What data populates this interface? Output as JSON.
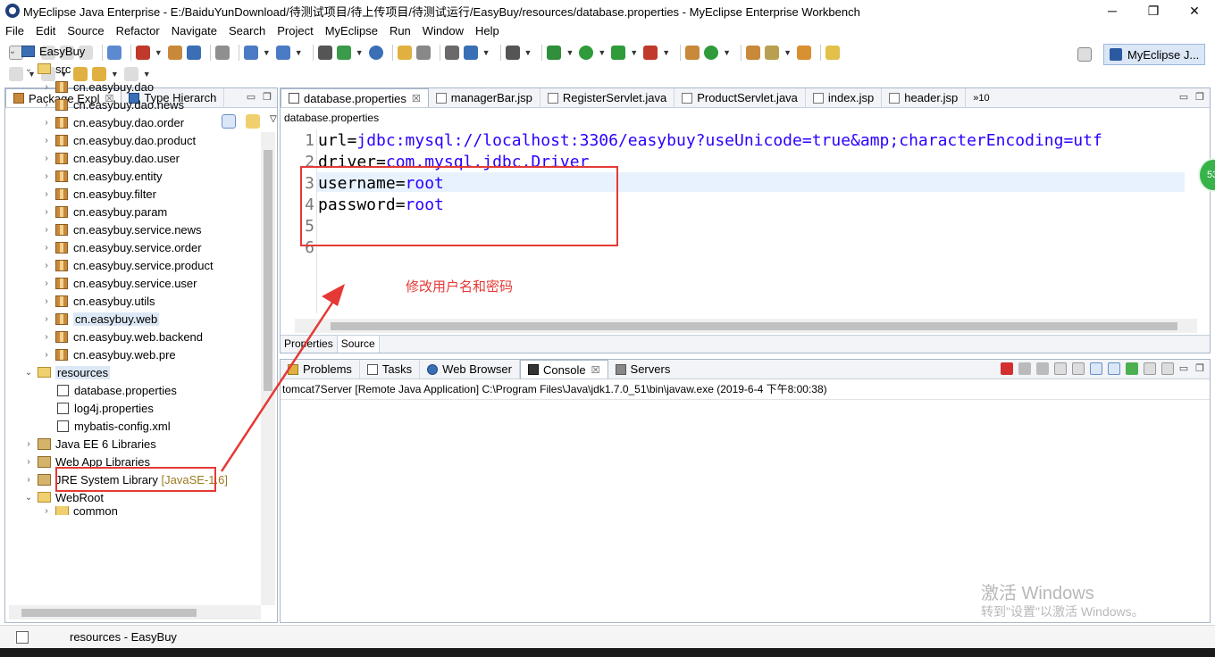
{
  "window": {
    "title": "MyEclipse Java Enterprise - E:/BaiduYunDownload/待测试项目/待上传项目/待测试运行/EasyBuy/resources/database.properties - MyEclipse Enterprise Workbench",
    "min": "─",
    "max": "❐",
    "close": "✕"
  },
  "menu": [
    "File",
    "Edit",
    "Source",
    "Refactor",
    "Navigate",
    "Search",
    "Project",
    "MyEclipse",
    "Run",
    "Window",
    "Help"
  ],
  "perspective": {
    "label": "MyEclipse J..."
  },
  "left_panel": {
    "tabs": [
      {
        "label": "Package Expl",
        "close": "☒"
      },
      {
        "label": "Type Hierarch"
      }
    ]
  },
  "tree": {
    "project": "EasyBuy",
    "src": "src",
    "packages": [
      "cn.easybuy.dao",
      "cn.easybuy.dao.news",
      "cn.easybuy.dao.order",
      "cn.easybuy.dao.product",
      "cn.easybuy.dao.user",
      "cn.easybuy.entity",
      "cn.easybuy.filter",
      "cn.easybuy.param",
      "cn.easybuy.service.news",
      "cn.easybuy.service.order",
      "cn.easybuy.service.product",
      "cn.easybuy.service.user",
      "cn.easybuy.utils",
      "cn.easybuy.web",
      "cn.easybuy.web.backend",
      "cn.easybuy.web.pre"
    ],
    "resources": "resources",
    "resource_files": [
      "database.properties",
      "log4j.properties",
      "mybatis-config.xml"
    ],
    "libraries": [
      {
        "name": "Java EE 6 Libraries",
        "extra": ""
      },
      {
        "name": "Web App Libraries",
        "extra": ""
      },
      {
        "name": "JRE System Library",
        "extra": "[JavaSE-1.6]"
      }
    ],
    "webroot": "WebRoot",
    "webroot_child": "common"
  },
  "editor": {
    "tabs": [
      {
        "label": "database.properties",
        "close": "☒"
      },
      {
        "label": "managerBar.jsp"
      },
      {
        "label": "RegisterServlet.java"
      },
      {
        "label": "ProductServlet.java"
      },
      {
        "label": "index.jsp"
      },
      {
        "label": "header.jsp"
      }
    ],
    "overflow": "»10",
    "breadcrumb": "database.properties",
    "lines": [
      {
        "num": "1",
        "key": "url=",
        "val": "jdbc:mysql://localhost:3306/easybuy?useUnicode=true&amp;characterEncoding=utf"
      },
      {
        "num": "2",
        "key": "driver=",
        "val": "com.mysql.jdbc.Driver"
      },
      {
        "num": "3",
        "key": "username=",
        "val": "root"
      },
      {
        "num": "4",
        "key": "password=",
        "val": "root"
      },
      {
        "num": "5",
        "key": "",
        "val": ""
      },
      {
        "num": "6",
        "key": "",
        "val": ""
      }
    ],
    "bottom_tabs": [
      "Properties",
      "Source"
    ]
  },
  "console": {
    "tabs": [
      {
        "label": "Problems"
      },
      {
        "label": "Tasks"
      },
      {
        "label": "Web Browser"
      },
      {
        "label": "Console",
        "close": "☒"
      },
      {
        "label": "Servers"
      }
    ],
    "header": "tomcat7Server [Remote Java Application] C:\\Program Files\\Java\\jdk1.7.0_51\\bin\\javaw.exe (2019-6-4 下午8:00:38)"
  },
  "status": {
    "text": "resources - EasyBuy"
  },
  "annotation": {
    "text": "修改用户名和密码"
  },
  "watermark": {
    "line1": "激活 Windows",
    "line2": "转到\"设置\"以激活 Windows。"
  },
  "badge": "53",
  "colors": {
    "annotation": "#e53935",
    "string_value": "#2a00ff",
    "selection": "#dde8f6"
  }
}
